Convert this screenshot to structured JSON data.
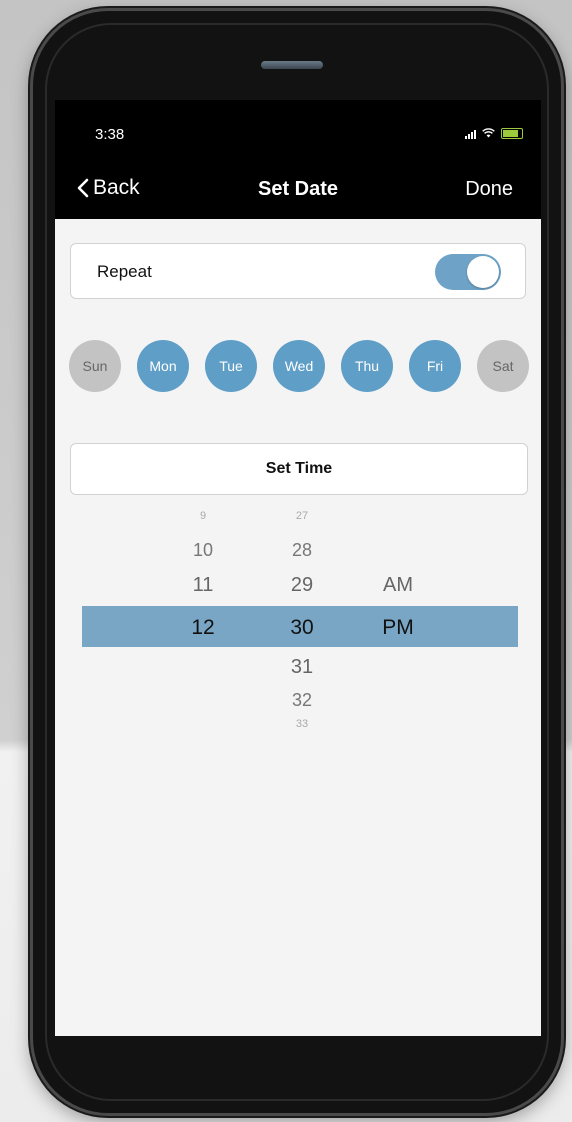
{
  "status_bar": {
    "time": "3:38"
  },
  "nav": {
    "back_label": "Back",
    "title": "Set Date",
    "done_label": "Done"
  },
  "repeat": {
    "label": "Repeat",
    "enabled": true
  },
  "days": [
    {
      "label": "Sun",
      "selected": false
    },
    {
      "label": "Mon",
      "selected": true
    },
    {
      "label": "Tue",
      "selected": true
    },
    {
      "label": "Wed",
      "selected": true
    },
    {
      "label": "Thu",
      "selected": true
    },
    {
      "label": "Fri",
      "selected": true
    },
    {
      "label": "Sat",
      "selected": false
    }
  ],
  "set_time": {
    "label": "Set Time"
  },
  "picker": {
    "hours": {
      "above": [
        "9",
        "10",
        "11"
      ],
      "selected": "12"
    },
    "minutes": {
      "above": [
        "27",
        "28",
        "29"
      ],
      "selected": "30",
      "below": [
        "31",
        "32",
        "33"
      ]
    },
    "ampm": {
      "above": [
        "AM"
      ],
      "selected": "PM"
    }
  },
  "colors": {
    "accent": "#5e9ec7",
    "toggle_on": "#6ea3c7",
    "picker_highlight": "#79a6c4",
    "day_off": "#c3c3c3",
    "nav_bar": "#000000"
  }
}
